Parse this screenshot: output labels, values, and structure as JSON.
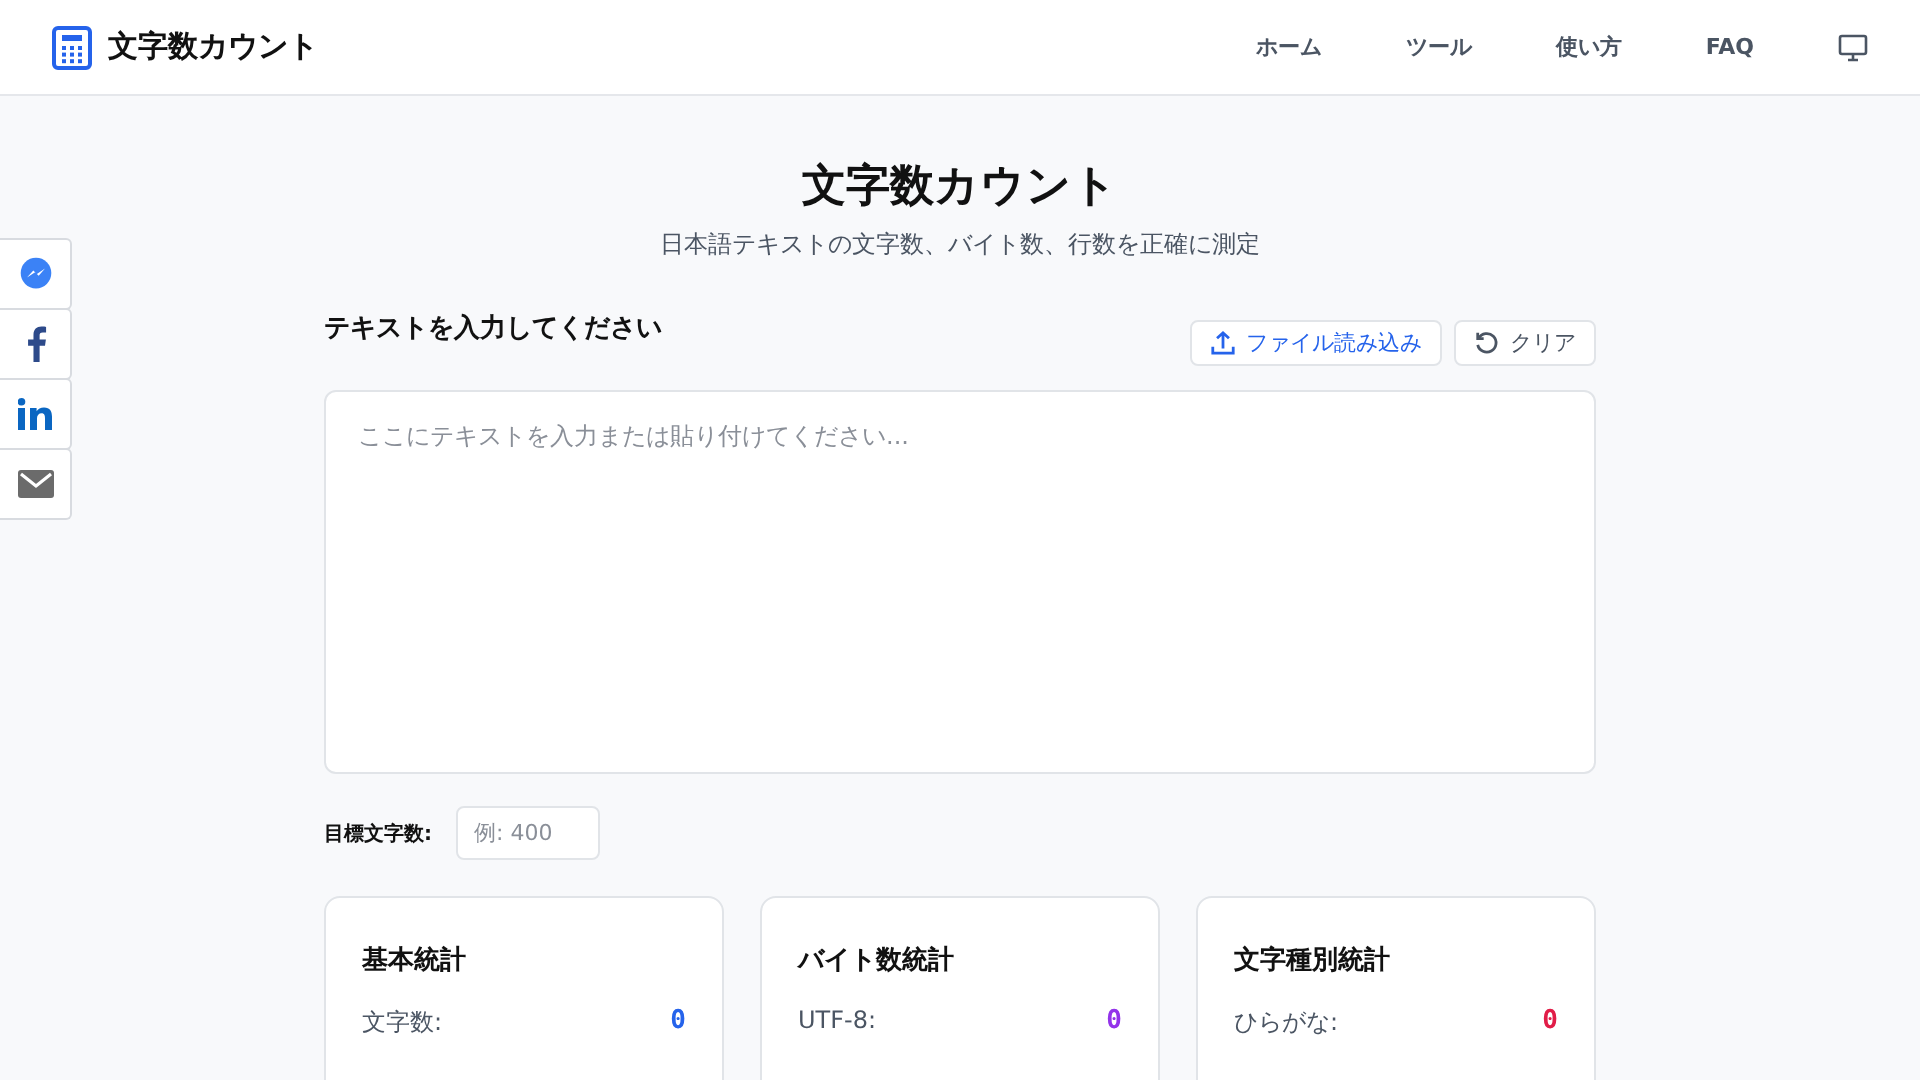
{
  "header": {
    "logo_text": "文字数カウント",
    "nav": [
      {
        "label": "ホーム"
      },
      {
        "label": "ツール"
      },
      {
        "label": "使い方"
      },
      {
        "label": "FAQ"
      }
    ]
  },
  "share_bar": [
    {
      "kind": "messenger"
    },
    {
      "kind": "facebook"
    },
    {
      "kind": "linkedin"
    },
    {
      "kind": "email"
    }
  ],
  "title": "文字数カウント",
  "subtitle": "日本語テキストの文字数、バイト数、行数を正確に測定",
  "input_label": "テキストを入力してください",
  "buttons": [
    {
      "kind": "upload",
      "label": "ファイル読み込み"
    },
    {
      "kind": "clear",
      "label": "クリア"
    }
  ],
  "textarea": {
    "placeholder": "ここにテキストを入力または貼り付けてください..."
  },
  "target": {
    "label": "目標文字数:",
    "placeholder": "例: 400"
  },
  "cards": [
    {
      "title": "基本統計",
      "color": "#2563eb",
      "rows": [
        {
          "label": "文字数:",
          "value": "0"
        }
      ]
    },
    {
      "title": "バイト数統計",
      "color": "#9333ea",
      "rows": [
        {
          "label": "UTF-8:",
          "value": "0"
        }
      ]
    },
    {
      "title": "文字種別統計",
      "color": "#e11d48",
      "rows": [
        {
          "label": "ひらがな:",
          "value": "0"
        }
      ]
    }
  ]
}
